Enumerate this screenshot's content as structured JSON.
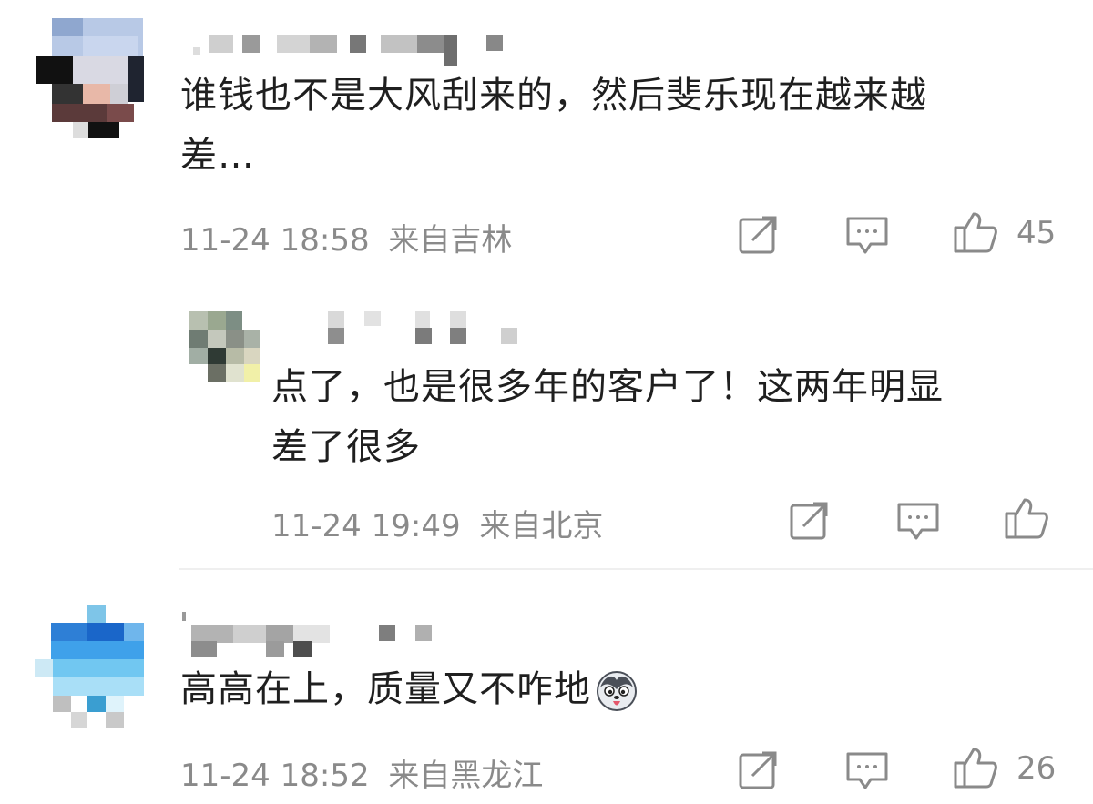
{
  "comments": [
    {
      "text": "谁钱也不是大风刮来的，然后斐乐现在越来越差…",
      "text_line1": "谁钱也不是大风刮来的，然后斐乐现在越来越",
      "text_line2": "差…",
      "time": "11-24 18:58",
      "location": "来自吉林",
      "likes": "45"
    },
    {
      "text": "点了，也是很多年的客户了！这两年明显差了很多",
      "text_line1": "点了，也是很多年的客户了！这两年明显",
      "text_line2": "差了很多",
      "time": "11-24 19:49",
      "location": "来自北京",
      "likes": ""
    },
    {
      "text": "高高在上，质量又不咋地",
      "text_line1": "高高在上，质量又不咋地",
      "time": "11-24 18:52",
      "location": "来自黑龙江",
      "likes": "26",
      "emoji": "husky-emoji"
    }
  ],
  "icons": [
    "share-icon",
    "comment-icon",
    "like-icon"
  ],
  "colors": {
    "text": "#1f1f1f",
    "meta": "#8a8a8a",
    "background": "#ffffff"
  }
}
